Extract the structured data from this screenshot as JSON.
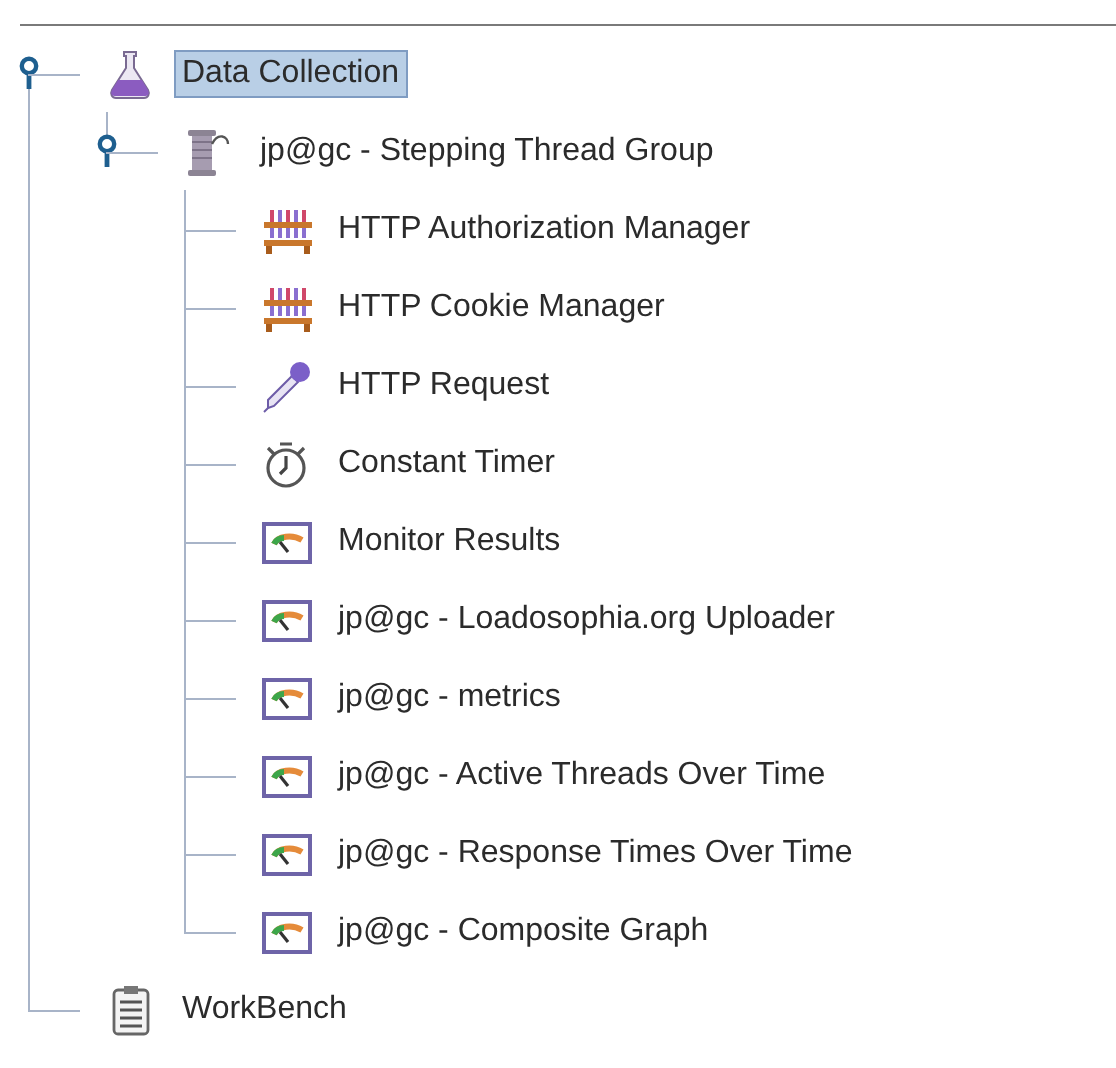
{
  "tree": {
    "nodes": [
      {
        "label": "Data Collection",
        "kind": "test-plan",
        "selected": true,
        "expanded": true,
        "children": [
          {
            "label": "jp@gc - Stepping Thread Group",
            "kind": "thread-group",
            "selected": false,
            "expanded": true,
            "children": [
              {
                "label": "HTTP Authorization Manager",
                "kind": "config",
                "selected": false
              },
              {
                "label": "HTTP Cookie Manager",
                "kind": "config",
                "selected": false
              },
              {
                "label": "HTTP Request",
                "kind": "sampler",
                "selected": false
              },
              {
                "label": "Constant Timer",
                "kind": "timer",
                "selected": false
              },
              {
                "label": "Monitor Results",
                "kind": "listener",
                "selected": false
              },
              {
                "label": "jp@gc - Loadosophia.org Uploader",
                "kind": "listener",
                "selected": false
              },
              {
                "label": "jp@gc - metrics",
                "kind": "listener",
                "selected": false
              },
              {
                "label": "jp@gc - Active Threads Over Time",
                "kind": "listener",
                "selected": false
              },
              {
                "label": "jp@gc - Response Times Over Time",
                "kind": "listener",
                "selected": false
              },
              {
                "label": "jp@gc - Composite Graph",
                "kind": "listener",
                "selected": false
              }
            ]
          }
        ]
      },
      {
        "label": "WorkBench",
        "kind": "workbench",
        "selected": false
      }
    ]
  }
}
